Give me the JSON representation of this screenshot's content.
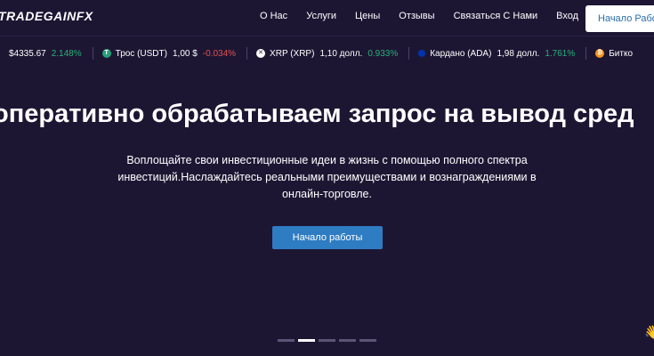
{
  "brand": {
    "name": "TRADEGAINFX"
  },
  "nav": {
    "items": [
      "О Нас",
      "Услуги",
      "Цены",
      "Отзывы",
      "Связаться С Нами",
      "Вход"
    ],
    "cta": "Начало Работы"
  },
  "ticker": [
    {
      "name": "",
      "price": "$4335.67",
      "change": "2.148%",
      "direction": "up",
      "icon": "ethereum-icon",
      "color": ""
    },
    {
      "name": "Трос (USDT)",
      "price": "1,00 $",
      "change": "-0.034%",
      "direction": "down",
      "icon": "tether-icon",
      "color": "#26a17b"
    },
    {
      "name": "XRP (XRP)",
      "price": "1,10 долл.",
      "change": "0.933%",
      "direction": "up",
      "icon": "xrp-icon",
      "color": "#23292f"
    },
    {
      "name": "Кардано (ADA)",
      "price": "1,98 долл.",
      "change": "1.761%",
      "direction": "up",
      "icon": "cardano-icon",
      "color": "#0033ad"
    },
    {
      "name": "Битко",
      "price": "",
      "change": "",
      "direction": "up",
      "icon": "bitcoin-icon",
      "color": "#f7931a"
    }
  ],
  "hero": {
    "title": "оперативно обрабатываем запрос на вывод сред",
    "subtitle": "Воплощайте свои инвестиционные идеи в жизнь с помощью полного спектра инвестиций.Наслаждайтесь реальными преимуществами и вознаграждениями в онлайн-торговле.",
    "button": "Начало работы"
  },
  "slider": {
    "count": 5,
    "active": 1
  }
}
